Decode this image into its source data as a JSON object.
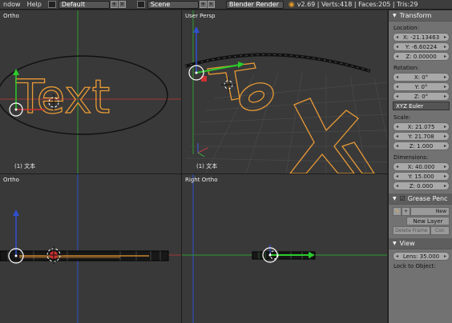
{
  "header": {
    "menus": [
      "ndow",
      "Help"
    ],
    "layout": "Default",
    "scene": "Scene",
    "engine": "Blender Render",
    "stats": "v2.69 | Verts:418 | Faces:205 | Tris:29"
  },
  "viewports": {
    "top_left": {
      "label": "Ortho",
      "footer": "(1) 文本"
    },
    "top_right": {
      "label": "User Persp",
      "footer": "(1) 文本"
    },
    "bottom_left": {
      "label": "Ortho"
    },
    "bottom_right": {
      "label": "Right Ortho"
    }
  },
  "scene_text": "Text",
  "panel": {
    "transform_title": "Transform",
    "location_label": "Location:",
    "location": [
      "X: -21.13463",
      "Y: -6.60224",
      "Z: 0.00000"
    ],
    "rotation_label": "Rotation:",
    "rotation": [
      "X: 0°",
      "Y: 0°",
      "Z: 0°"
    ],
    "rotation_mode": "XYZ Euler",
    "scale_label": "Scale:",
    "scale": [
      "X: 21.075",
      "Y: 21.708",
      "Z: 1.000"
    ],
    "dimensions_label": "Dimensions:",
    "dimensions": [
      "X: 40.000",
      "Y: 15.000",
      "Z: 0.000"
    ],
    "grease_title": "Grease Penc",
    "new_label": "New",
    "new_layer": "New Layer",
    "delete_frame": "Delete Frame",
    "con_label": "Con",
    "view_title": "View",
    "lens": "Lens: 35.000",
    "lock_label": "Lock to Object:"
  },
  "colors": {
    "curve": "#f0a030",
    "x_axis": "#b03030",
    "y_axis": "#30b030",
    "z_axis": "#3050d0"
  }
}
